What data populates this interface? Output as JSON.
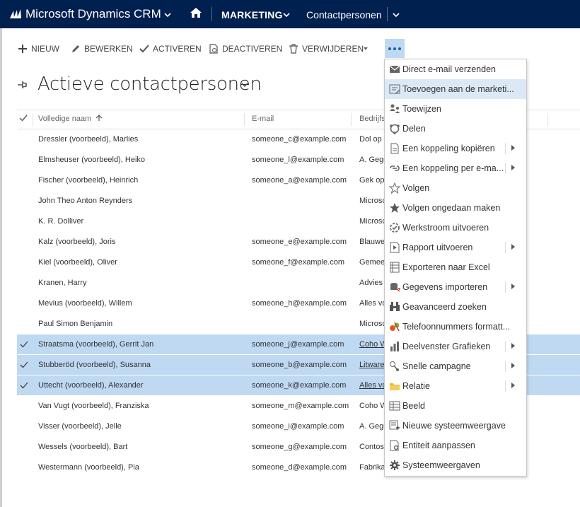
{
  "nav": {
    "brand": "Microsoft Dynamics CRM",
    "area": "MARKETING",
    "entity": "Contactpersonen"
  },
  "commands": [
    {
      "label": "NIEUW",
      "icon": "plus-icon"
    },
    {
      "label": "BEWERKEN",
      "icon": "pencil-icon"
    },
    {
      "label": "ACTIVEREN",
      "icon": "checkmark-icon"
    },
    {
      "label": "DEACTIVEREN",
      "icon": "deactivate-icon"
    },
    {
      "label": "VERWIJDEREN",
      "icon": "trash-icon"
    }
  ],
  "view": {
    "title": "Actieve contactpersonen"
  },
  "grid": {
    "headers": {
      "name": "Volledige naam",
      "email": "E-mail",
      "company": "Bedrijfs"
    },
    "rows": [
      {
        "name": "Dressler (voorbeeld), Marlies",
        "email": "someone_c@example.com",
        "company": "Dol op",
        "selected": false
      },
      {
        "name": "Elmsheuser (voorbeeld), Heiko",
        "email": "someone_l@example.com",
        "company": "A. Gege",
        "selected": false
      },
      {
        "name": "Fischer (voorbeeld), Heinrich",
        "email": "someone_a@example.com",
        "company": "Gek op",
        "selected": false
      },
      {
        "name": "John Theo Anton Reynders",
        "email": "",
        "company": "Microsc",
        "selected": false
      },
      {
        "name": "K. R. Dolliver",
        "email": "",
        "company": "Microsc",
        "selected": false
      },
      {
        "name": "Kalz (voorbeeld), Joris",
        "email": "someone_e@example.com",
        "company": "Blauwe",
        "selected": false
      },
      {
        "name": "Kiel (voorbeeld), Oliver",
        "email": "someone_f@example.com",
        "company": "Gemee",
        "selected": false
      },
      {
        "name": "Kranen, Harry",
        "email": "",
        "company": "Advies",
        "selected": false
      },
      {
        "name": "Mevius (voorbeeld), Willem",
        "email": "someone_h@example.com",
        "company": "Alles vo",
        "selected": false
      },
      {
        "name": "Paul Simon Benjamin",
        "email": "",
        "company": "Microsc",
        "selected": false
      },
      {
        "name": "Straatsma (voorbeeld), Gerrit Jan",
        "email": "someone_j@example.com",
        "company": "Coho W",
        "selected": true
      },
      {
        "name": "Stubberöd (voorbeeld), Susanna",
        "email": "someone_b@example.com",
        "company": "Litware",
        "selected": true
      },
      {
        "name": "Uttecht (voorbeeld), Alexander",
        "email": "someone_k@example.com",
        "company": "Alles vo",
        "selected": true
      },
      {
        "name": "Van Vugt (voorbeeld), Franziska",
        "email": "someone_m@example.com",
        "company": "Coho W",
        "selected": false
      },
      {
        "name": "Visser (voorbeeld), Jelle",
        "email": "someone_i@example.com",
        "company": "A. Gege",
        "selected": false
      },
      {
        "name": "Wessels (voorbeeld), Bart",
        "email": "someone_g@example.com",
        "company": "Contos",
        "selected": false
      },
      {
        "name": "Westermann (voorbeeld), Pia",
        "email": "someone_d@example.com",
        "company": "Fabrika",
        "selected": false
      }
    ]
  },
  "menu": [
    {
      "label": "Direct e-mail verzenden",
      "icon": "envelope-icon",
      "submenu": false,
      "highlighted": false
    },
    {
      "label": "Toevoegen aan de marketi...",
      "icon": "marketing-list-icon",
      "submenu": false,
      "highlighted": true
    },
    {
      "label": "Toewijzen",
      "icon": "assign-icon",
      "submenu": false,
      "highlighted": false
    },
    {
      "label": "Delen",
      "icon": "share-icon",
      "submenu": false,
      "highlighted": false
    },
    {
      "label": "Een koppeling kopiëren",
      "icon": "copy-link-icon",
      "submenu": true,
      "highlighted": false
    },
    {
      "label": "Een koppeling per e-ma...",
      "icon": "email-link-icon",
      "submenu": true,
      "highlighted": false
    },
    {
      "label": "Volgen",
      "icon": "star-outline-icon",
      "submenu": false,
      "highlighted": false
    },
    {
      "label": "Volgen ongedaan maken",
      "icon": "star-filled-icon",
      "submenu": false,
      "highlighted": false
    },
    {
      "label": "Werkstroom uitvoeren",
      "icon": "workflow-icon",
      "submenu": false,
      "highlighted": false
    },
    {
      "label": "Rapport uitvoeren",
      "icon": "report-icon",
      "submenu": true,
      "highlighted": false
    },
    {
      "label": "Exporteren naar Excel",
      "icon": "excel-icon",
      "submenu": false,
      "highlighted": false
    },
    {
      "label": "Gegevens importeren",
      "icon": "import-icon",
      "submenu": true,
      "highlighted": false
    },
    {
      "label": "Geavanceerd zoeken",
      "icon": "binoculars-icon",
      "submenu": false,
      "highlighted": false
    },
    {
      "label": "Telefoonnummers formatt...",
      "icon": "phone-format-icon",
      "submenu": false,
      "highlighted": false
    },
    {
      "label": "Deelvenster Grafieken",
      "icon": "chart-icon",
      "submenu": true,
      "highlighted": false
    },
    {
      "label": "Snelle campagne",
      "icon": "campaign-icon",
      "submenu": true,
      "highlighted": false
    },
    {
      "label": "Relatie",
      "icon": "folder-icon",
      "submenu": true,
      "highlighted": false
    },
    {
      "label": "Beeld",
      "icon": "view-grid-icon",
      "submenu": false,
      "highlighted": false
    },
    {
      "label": "Nieuwe systeemweergave",
      "icon": "new-view-icon",
      "submenu": false,
      "highlighted": false
    },
    {
      "label": "Entiteit aanpassen",
      "icon": "customize-entity-icon",
      "submenu": false,
      "highlighted": false
    },
    {
      "label": "Systeemweergaven",
      "icon": "gear-icon",
      "submenu": false,
      "highlighted": false
    }
  ],
  "colors": {
    "nav_bg": "#002050",
    "selection": "#bfd9f2",
    "menu_highlight": "#dbe9f7"
  }
}
